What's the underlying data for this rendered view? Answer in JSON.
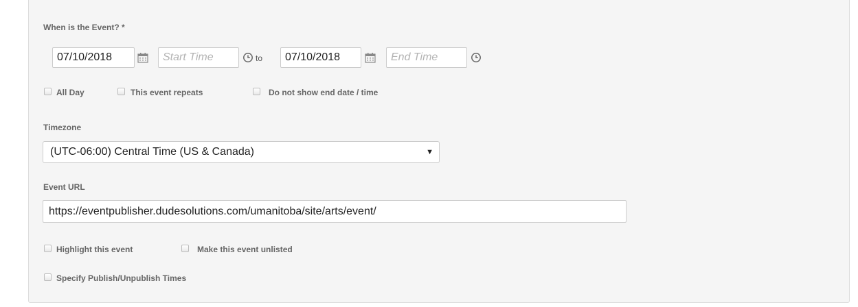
{
  "when": {
    "label": "When is the Event? *",
    "start_date": "07/10/2018",
    "start_time_placeholder": "Start Time",
    "to_text": "to",
    "end_date": "07/10/2018",
    "end_time_placeholder": "End Time"
  },
  "options": {
    "all_day": "All Day",
    "repeats": "This event repeats",
    "no_end": "Do not show end date / time"
  },
  "timezone": {
    "label": "Timezone",
    "selected": "(UTC-06:00) Central Time (US & Canada)"
  },
  "event_url": {
    "label": "Event URL",
    "value": "https://eventpublisher.dudesolutions.com/umanitoba/site/arts/event/"
  },
  "flags": {
    "highlight": "Highlight this event",
    "unlisted": "Make this event unlisted",
    "publish_times": "Specify Publish/Unpublish Times"
  },
  "icons": {
    "calendar": "calendar-icon",
    "clock": "clock-icon",
    "dropdown": "chevron-down-icon"
  },
  "colors": {
    "panel_bg": "#f5f5f5",
    "label": "#666666",
    "placeholder": "#b3b3b3"
  }
}
